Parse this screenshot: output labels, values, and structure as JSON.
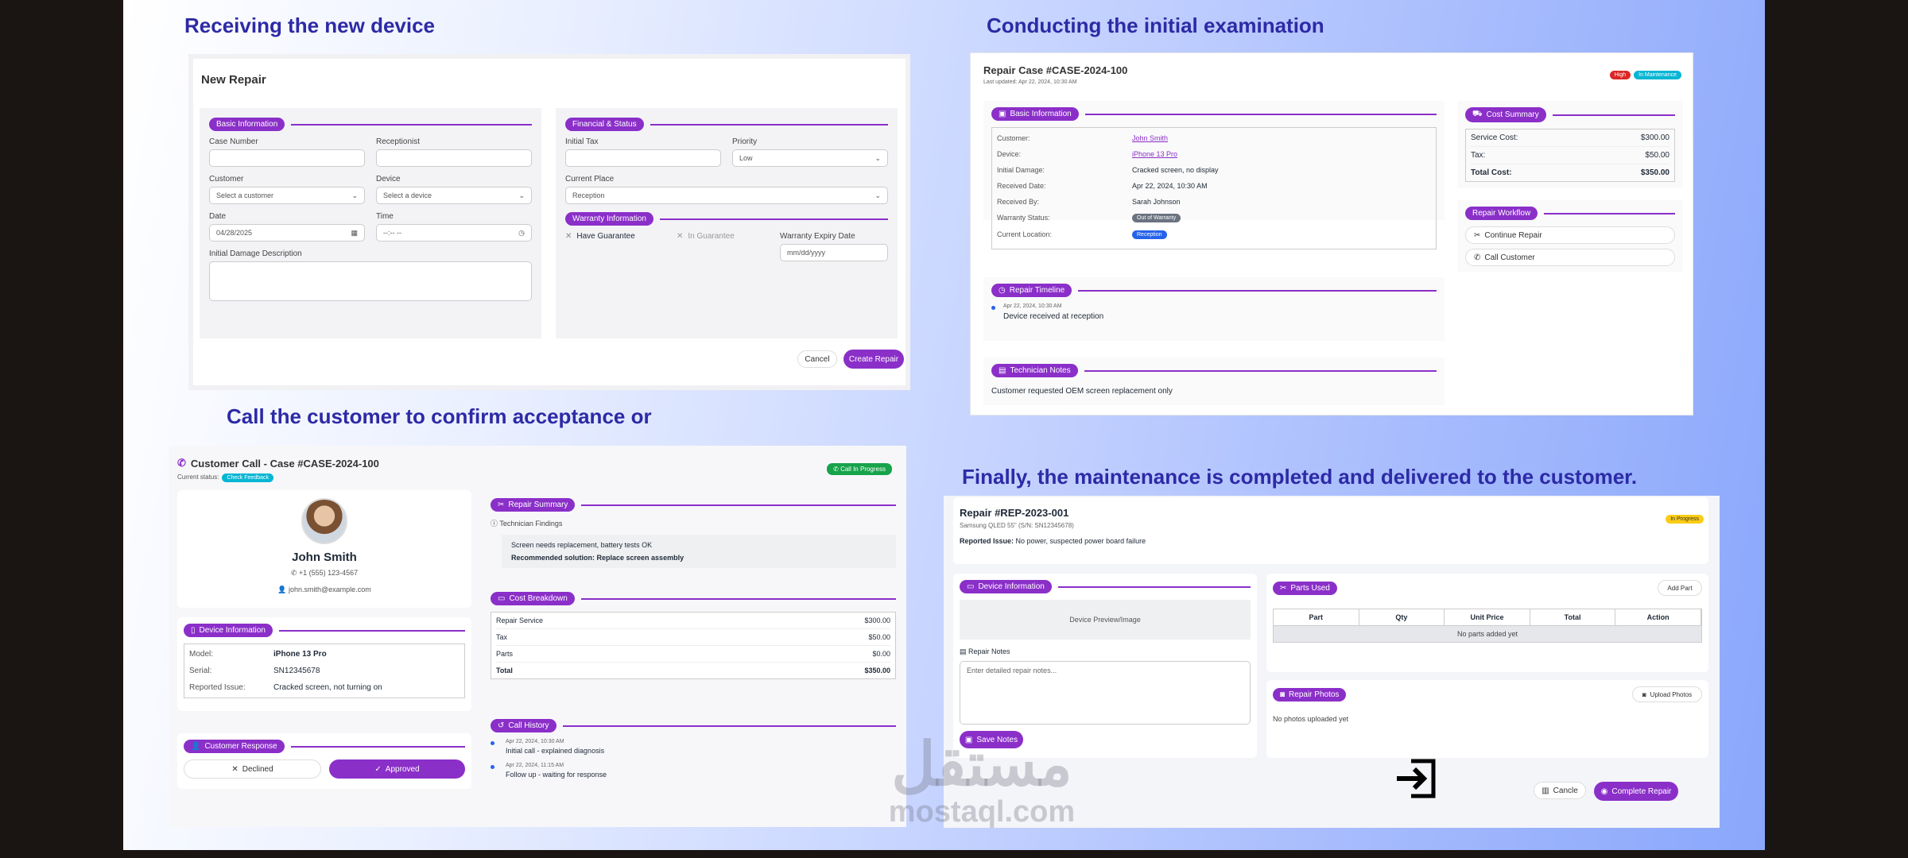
{
  "headings": {
    "h1": "Receiving the new device",
    "h2": "Conducting the initial examination",
    "h3": "Call the customer to confirm acceptance or",
    "h4": "Finally, the maintenance is completed and delivered to the customer."
  },
  "new_repair": {
    "title": "New Repair",
    "basic_info": "Basic Information",
    "case_number_label": "Case Number",
    "receptionist_label": "Receptionist",
    "customer_label": "Customer",
    "customer_placeholder": "Select a customer",
    "device_label": "Device",
    "device_placeholder": "Select a device",
    "date_label": "Date",
    "date_value": "04/28/2025",
    "time_label": "Time",
    "time_value": "--:-- --",
    "damage_label": "Initial Damage Description",
    "financial": "Financial & Status",
    "initial_tax_label": "Initial Tax",
    "priority_label": "Priority",
    "priority_value": "Low",
    "current_place_label": "Current Place",
    "current_place_value": "Reception",
    "warranty_info": "Warranty Information",
    "have_guarantee": "Have Guarantee",
    "in_guarantee": "In Guarantee",
    "warranty_expiry_label": "Warranty Expiry Date",
    "warranty_expiry_placeholder": "mm/dd/yyyy",
    "cancel": "Cancel",
    "create": "Create Repair"
  },
  "repair_case": {
    "title": "Repair Case #CASE-2024-100",
    "updated": "Last updated: Apr 22, 2024, 10:30 AM",
    "badge_high": "High",
    "badge_maint": "In Maintenance",
    "basic_info": "Basic Information",
    "rows": [
      {
        "k": "Customer:",
        "v": "John Smith"
      },
      {
        "k": "Device:",
        "v": "iPhone 13 Pro"
      },
      {
        "k": "Initial Damage:",
        "v": "Cracked screen, no display"
      },
      {
        "k": "Received Date:",
        "v": "Apr 22, 2024, 10:30 AM"
      },
      {
        "k": "Received By:",
        "v": "Sarah Johnson"
      },
      {
        "k": "Warranty Status:",
        "v": "Out of Warranty"
      },
      {
        "k": "Current Location:",
        "v": "Reception"
      }
    ],
    "cost_summary": "Cost Summary",
    "service_cost_label": "Service Cost:",
    "service_cost": "$300.00",
    "tax_label": "Tax:",
    "tax": "$50.00",
    "total_label": "Total Cost:",
    "total": "$350.00",
    "workflow": "Repair Workflow",
    "continue": "Continue Repair",
    "call": "Call Customer",
    "timeline": "Repair Timeline",
    "timeline_date": "Apr 22, 2024, 10:30 AM",
    "timeline_text": "Device received at reception",
    "tech_notes": "Technician Notes",
    "tech_text": "Customer requested OEM screen replacement only"
  },
  "call": {
    "title": "Customer Call - Case #CASE-2024-100",
    "status_label": "Current status:",
    "status_badge": "Check Feedback",
    "progress": "Call In Progress",
    "name": "John Smith",
    "phone": "+1 (555) 123-4567",
    "email": "john.smith@example.com",
    "device_info": "Device Information",
    "model_label": "Model:",
    "model": "iPhone 13 Pro",
    "serial_label": "Serial:",
    "serial": "SN12345678",
    "issue_label": "Reported Issue:",
    "issue": "Cracked screen, not turning on",
    "response": "Customer Response",
    "declined": "Declined",
    "approved": "Approved",
    "summary": "Repair Summary",
    "findings": "Technician Findings",
    "finding_text": "Screen needs replacement, battery tests OK",
    "recommendation": "Recommended solution: Replace screen assembly",
    "breakdown": "Cost Breakdown",
    "service_label": "Repair Service",
    "service": "$300.00",
    "tax_label": "Tax",
    "tax": "$50.00",
    "parts_label": "Parts",
    "parts": "$0.00",
    "total_label": "Total",
    "total": "$350.00",
    "history": "Call History",
    "h1_date": "Apr 22, 2024, 10:30 AM",
    "h1_text": "Initial call - explained diagnosis",
    "h2_date": "Apr 22, 2024, 11:15 AM",
    "h2_text": "Follow up - waiting for response"
  },
  "final": {
    "title": "Repair #REP-2023-001",
    "subtitle": "Samsung QLED 55\" (S/N: SN12345678)",
    "issue_label": "Reported Issue:",
    "issue": "No power, suspected power board failure",
    "badge": "In Progress",
    "device_info": "Device Information",
    "preview": "Device Preview/Image",
    "notes_label": "Repair Notes",
    "notes_placeholder": "Enter detailed repair notes...",
    "save": "Save Notes",
    "parts_used": "Parts Used",
    "add_part": "Add Part",
    "cols": [
      "Part",
      "Qty",
      "Unit Price",
      "Total",
      "Action"
    ],
    "no_parts": "No parts added yet",
    "photos": "Repair Photos",
    "upload": "Upload Photos",
    "no_photos": "No photos uploaded yet",
    "cancel": "Cancle",
    "complete": "Complete Repair"
  },
  "watermark": {
    "arabic": "مستقل",
    "latin": "mostaql.com"
  },
  "colors": {
    "accent": "#8b2fc9",
    "heading": "#2d2aa6",
    "green": "#16a34a",
    "cyan": "#06b6d4",
    "red": "#dc2626",
    "yellow": "#facc15"
  }
}
